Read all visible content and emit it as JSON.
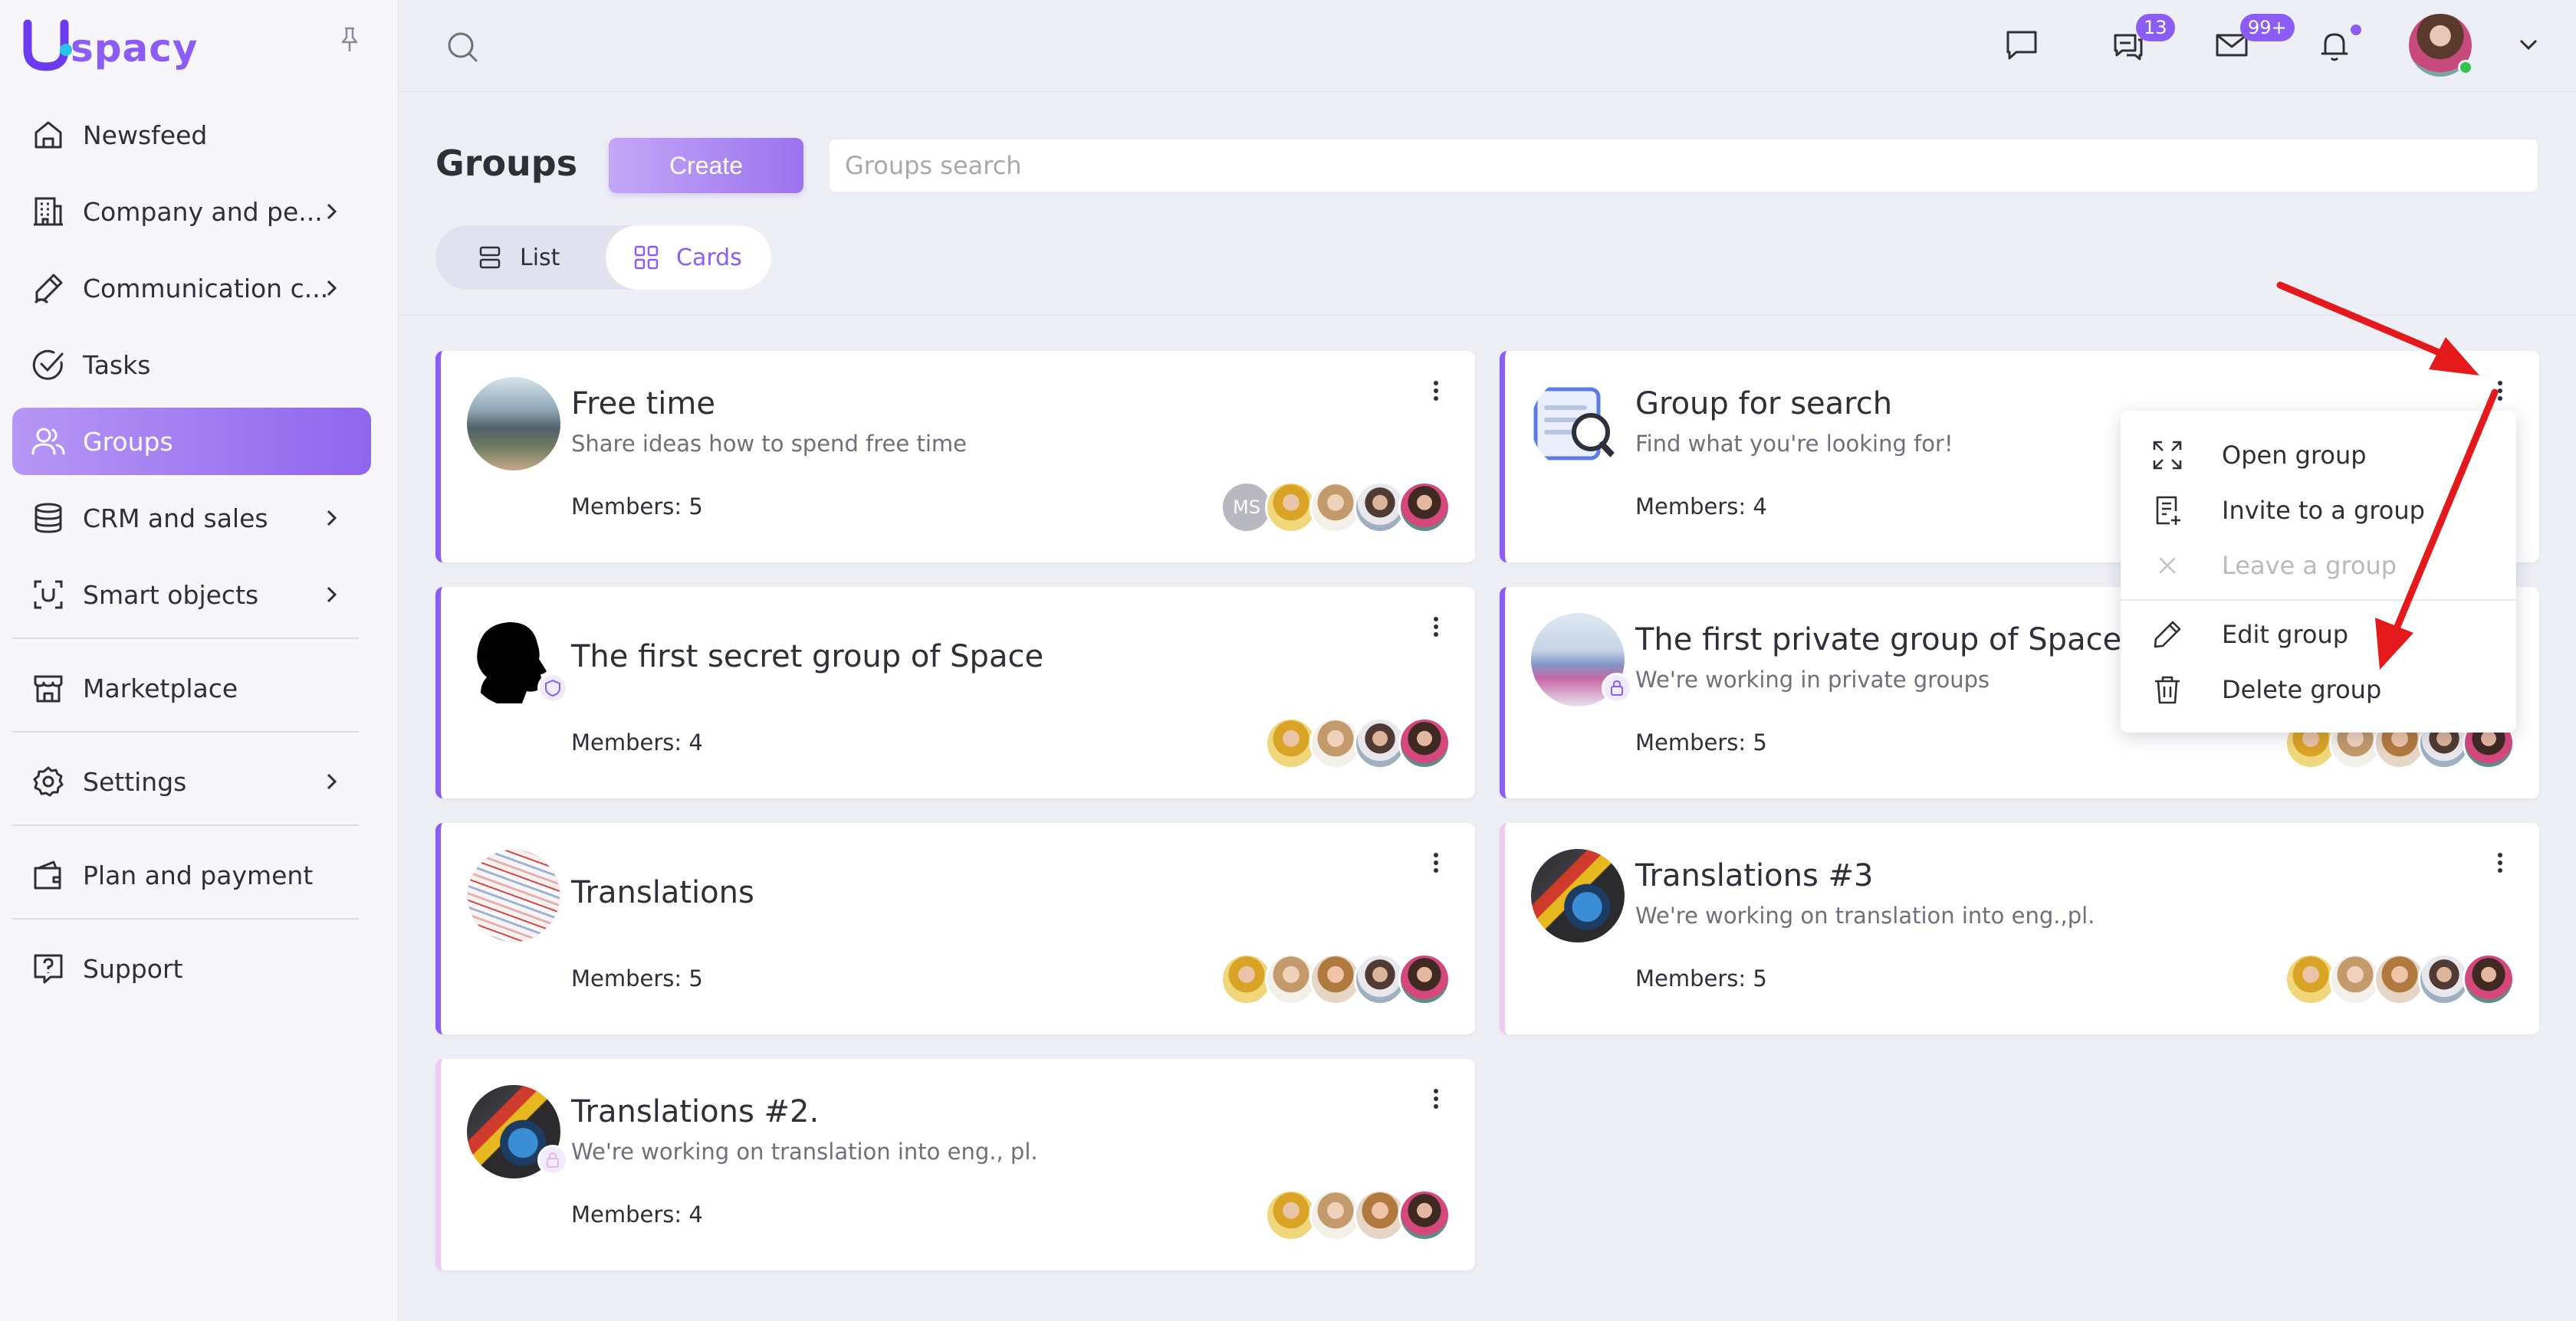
{
  "app": {
    "logo_text": "spacy",
    "brand_color": "#8b5cf6"
  },
  "sidebar": {
    "items": [
      {
        "label": "Newsfeed",
        "icon": "home-icon",
        "chevron": false
      },
      {
        "label": "Company and pe...",
        "icon": "building-icon",
        "chevron": true
      },
      {
        "label": "Communication c...",
        "icon": "pen-icon",
        "chevron": true
      },
      {
        "label": "Tasks",
        "icon": "check-circle-icon",
        "chevron": false
      },
      {
        "label": "Groups",
        "icon": "users-icon",
        "chevron": false,
        "active": true
      },
      {
        "label": "CRM and sales",
        "icon": "database-icon",
        "chevron": true
      },
      {
        "label": "Smart objects",
        "icon": "scan-icon",
        "chevron": true
      },
      {
        "label": "Marketplace",
        "icon": "store-icon",
        "chevron": false
      },
      {
        "label": "Settings",
        "icon": "gear-icon",
        "chevron": true
      },
      {
        "label": "Plan and payment",
        "icon": "wallet-icon",
        "chevron": false
      },
      {
        "label": "Support",
        "icon": "help-icon",
        "chevron": false
      }
    ]
  },
  "topbar": {
    "chat_badge": "13",
    "mail_badge": "99+"
  },
  "page": {
    "title": "Groups",
    "create_label": "Create",
    "search_placeholder": "Groups search",
    "view_list": "List",
    "view_cards": "Cards"
  },
  "groups": [
    {
      "title": "Free time",
      "description": "Share ideas how to spend free time",
      "members": "Members: 5",
      "avatar_initials": "MS"
    },
    {
      "title": "Group for search",
      "description": "Find what you're looking for!",
      "members": "Members: 4"
    },
    {
      "title": "The first secret group of Space",
      "description": "",
      "members": "Members: 4"
    },
    {
      "title": "The first private group of Space",
      "description": "We're working in private groups",
      "members": "Members: 5"
    },
    {
      "title": "Translations",
      "description": "",
      "members": "Members: 5"
    },
    {
      "title": "Translations #3",
      "description": "We're working on translation into eng.,pl.",
      "members": "Members: 5"
    },
    {
      "title": "Translations #2.",
      "description": "We're working on translation into eng., pl.",
      "members": "Members: 4"
    }
  ],
  "context_menu": {
    "items": [
      {
        "label": "Open group",
        "icon": "expand-icon",
        "disabled": false
      },
      {
        "label": "Invite to a group",
        "icon": "invite-icon",
        "disabled": false
      },
      {
        "label": "Leave a group",
        "icon": "close-icon",
        "disabled": true
      },
      {
        "label": "Edit group",
        "icon": "pencil-icon",
        "disabled": false
      },
      {
        "label": "Delete group",
        "icon": "trash-icon",
        "disabled": false
      }
    ]
  }
}
